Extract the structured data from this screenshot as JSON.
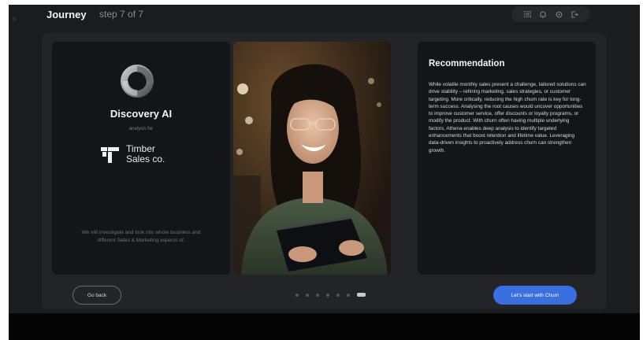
{
  "header": {
    "brand": "Journey",
    "step": "step 7 of 7",
    "actions": [
      {
        "icon": "grid-icon"
      },
      {
        "icon": "notification-icon"
      },
      {
        "icon": "settings-icon"
      },
      {
        "icon": "logout-icon"
      }
    ]
  },
  "left_card": {
    "product": "Discovery AI",
    "analysis_label": "analysis for",
    "client_name_line1": "Timber",
    "client_name_line2": "Sales co.",
    "description": "We will investigate and look into whole business and different Sales & Marketing aspects of."
  },
  "recommendation": {
    "title": "Recommendation",
    "body": "While volatile monthly sales present a challenge, tailored solutions can drive stability – refining marketing, sales strategies, or customer targeting. More critically, reducing the high churn rate is key for long-term success. Analysing the root causes would uncover opportunities to improve customer service, offer discounts or loyalty programs, or modify the product. With churn often having multiple underlying factors, Athena enables deep analysis to identify targeted enhancements that boost retention and lifetime value. Leveraging data-driven insights to proactively address churn can strengthen growth."
  },
  "footer": {
    "back_label": "Go back",
    "cta_label": "Let's start with Churn",
    "pager": {
      "total": 7,
      "current": 7
    }
  },
  "colors": {
    "accent": "#3a6fe0",
    "background": "#1b1c1f",
    "card": "#141518"
  }
}
